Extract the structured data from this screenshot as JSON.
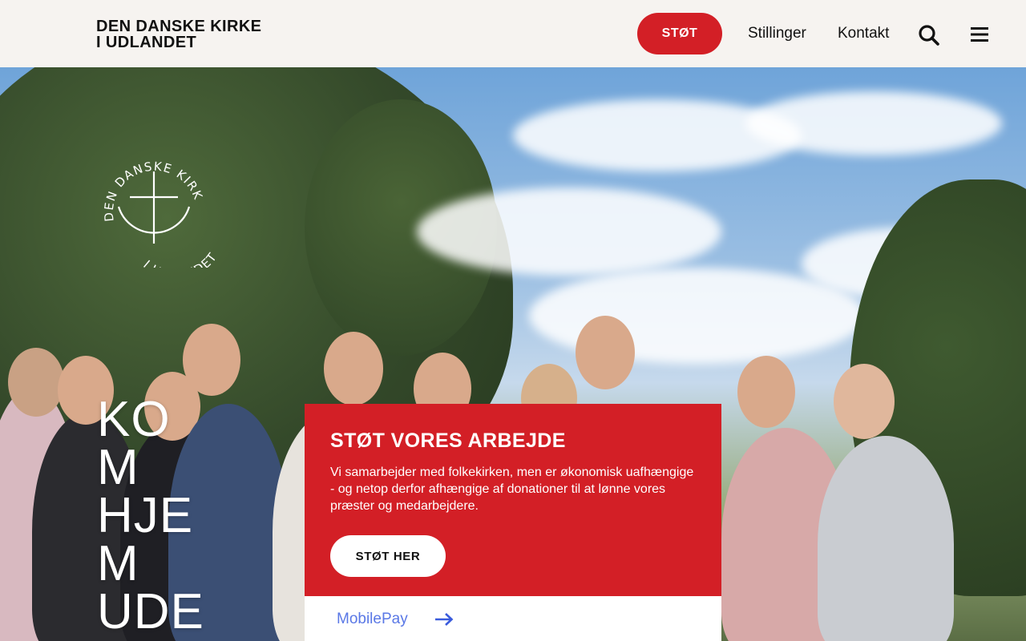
{
  "header": {
    "brand_line1": "DEN DANSKE KIRKE",
    "brand_line2": "I UDLANDET",
    "support_button": "STØT",
    "nav": {
      "stillinger": "Stillinger",
      "kontakt": "Kontakt"
    },
    "icons": {
      "search": "search-icon",
      "menu": "menu-icon"
    }
  },
  "hero": {
    "logo_text_top": "DEN DANSKE KIRKE",
    "logo_text_bottom": "I UDLANDET",
    "headline": [
      "KO",
      "M",
      "HJE",
      "M",
      "UDE"
    ]
  },
  "card": {
    "title": "STØT VORES ARBEJDE",
    "text": "Vi samarbejder med folkekirken, men er økonomisk uafhængige - og netop derfor afhængige af donationer til at lønne vores præster og medarbejdere.",
    "button": "STØT HER",
    "mobilepay": "MobilePay"
  },
  "colors": {
    "accent": "#d31f26",
    "link": "#5a78e6",
    "header_bg": "#f6f3f0"
  }
}
